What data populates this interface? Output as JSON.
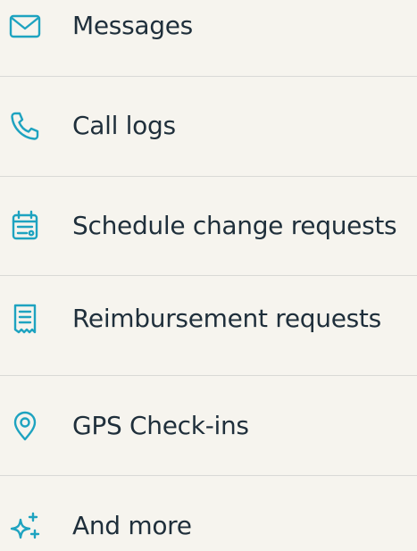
{
  "items": [
    {
      "label": "Messages",
      "icon": "envelope-icon"
    },
    {
      "label": "Call logs",
      "icon": "phone-icon"
    },
    {
      "label": "Schedule change requests",
      "icon": "calendar-icon"
    },
    {
      "label": "Reimbursement requests",
      "icon": "receipt-icon"
    },
    {
      "label": "GPS Check-ins",
      "icon": "location-pin-icon"
    },
    {
      "label": "And more",
      "icon": "sparkles-icon"
    }
  ],
  "colors": {
    "background": "#f6f4ee",
    "text": "#1f2f3b",
    "icon": "#1ea3c0",
    "divider": "#d9d9d6"
  }
}
